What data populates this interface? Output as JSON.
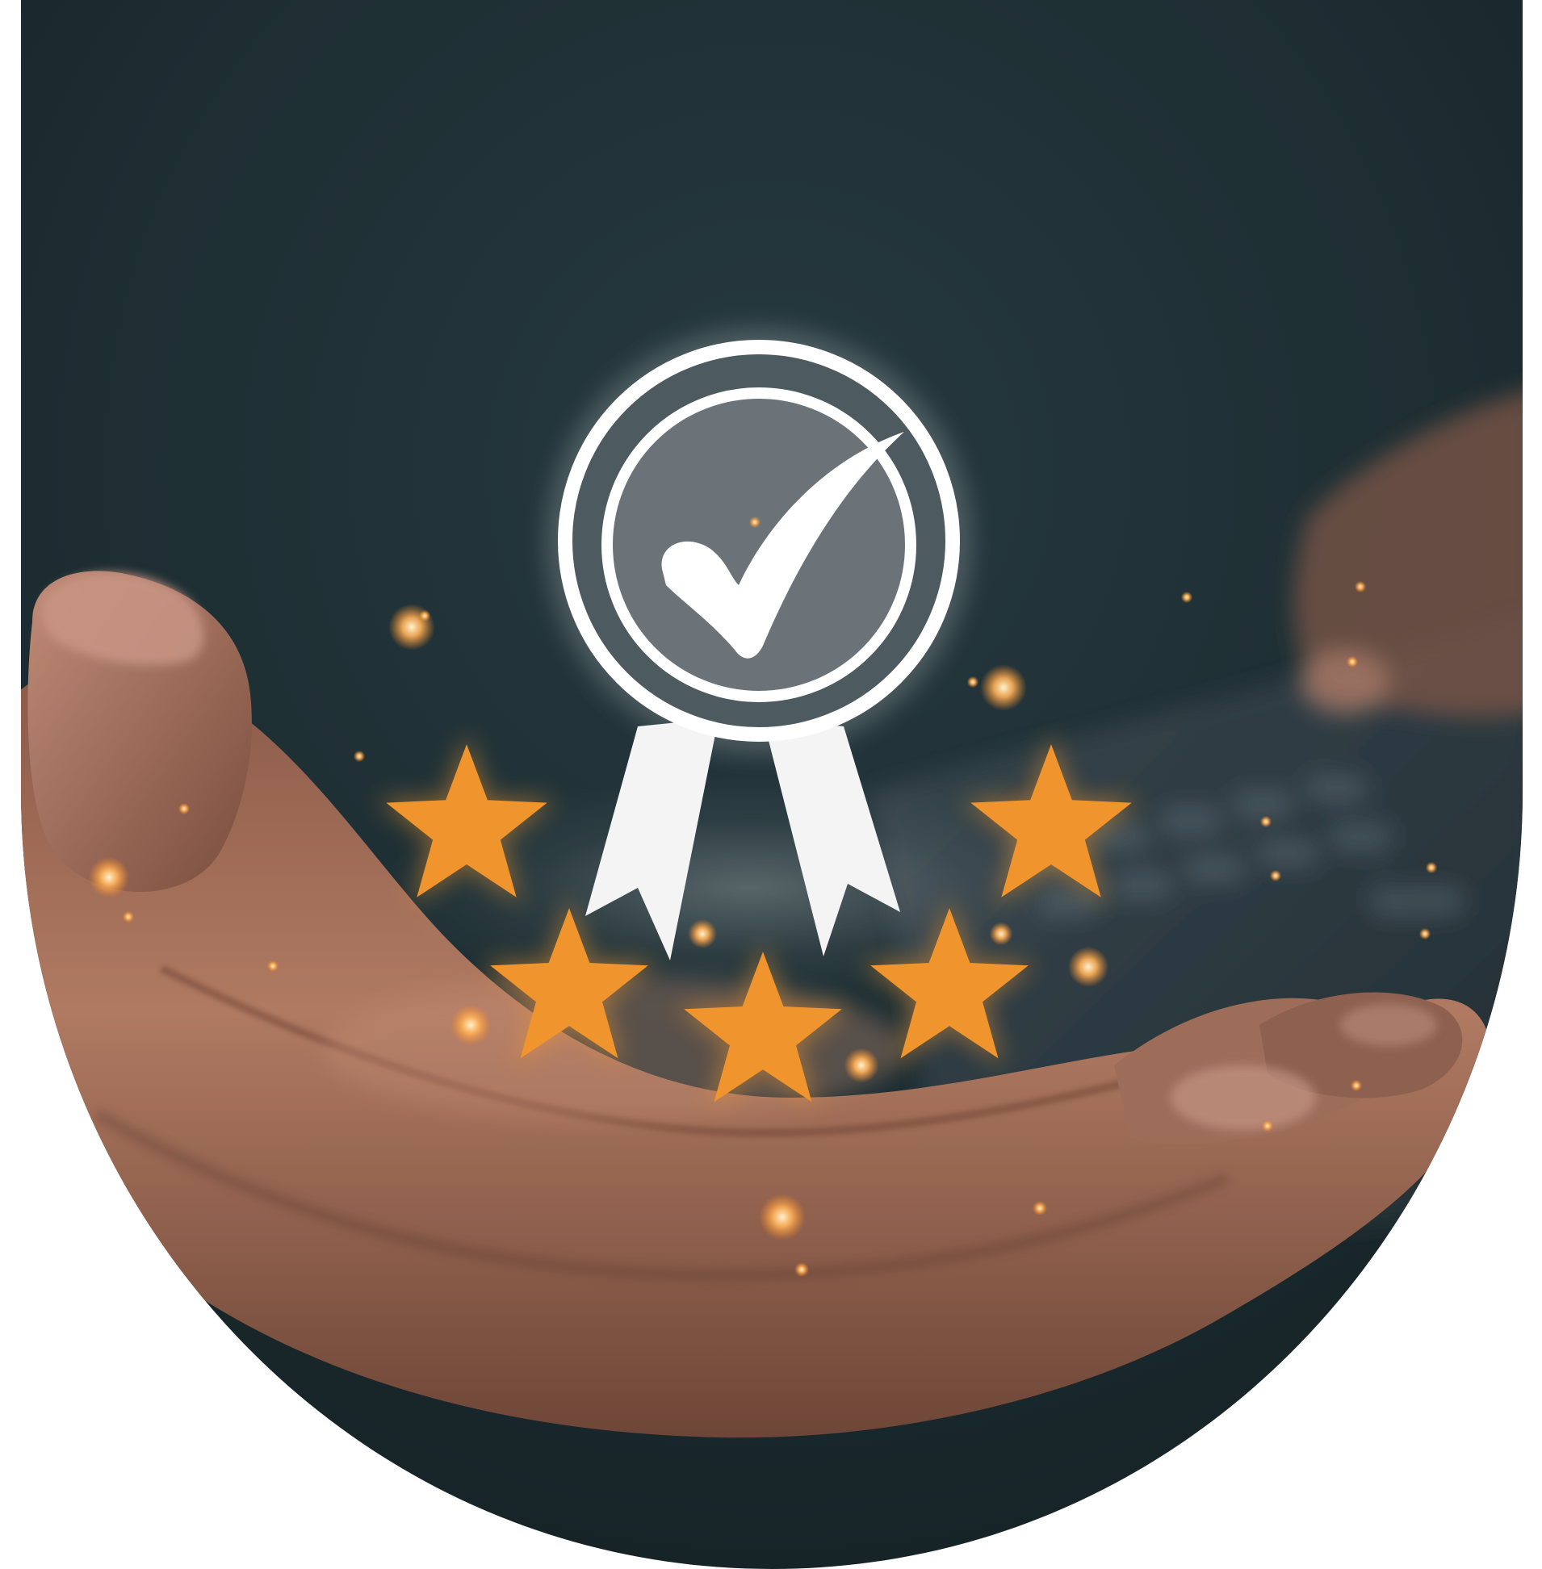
{
  "image": {
    "shape": "arch-bottom",
    "description_icons": [
      "award-badge-icon",
      "checkmark-icon",
      "star-icon"
    ]
  },
  "rating": {
    "stars_total": 5,
    "stars_filled": 5
  },
  "colors": {
    "background_outer": "#ffffff",
    "background_dark": "#1c2a2e",
    "background_teal": "#23363b",
    "skin_tone": "#a9705a",
    "skin_shadow": "#5b3b30",
    "star": "#f0952d",
    "badge_fill": "#6b7378",
    "badge_stroke": "#ffffff",
    "sparkle": "#ffb35a",
    "keyboard": "#2c3a42"
  }
}
